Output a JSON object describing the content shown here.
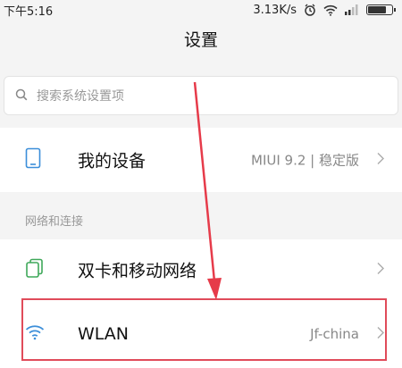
{
  "status_bar": {
    "time": "下午5:16",
    "speed": "3.13K/s"
  },
  "header": {
    "title": "设置"
  },
  "search": {
    "placeholder": "搜索系统设置项"
  },
  "my_device": {
    "label": "我的设备",
    "value": "MIUI 9.2 | 稳定版"
  },
  "sections": {
    "network": "网络和连接"
  },
  "sim": {
    "label": "双卡和移动网络"
  },
  "wlan": {
    "label": "WLAN",
    "value": "Jf-china"
  },
  "colors": {
    "highlight": "#e04b5a",
    "icon_blue": "#3b8ed9",
    "icon_green": "#3fa85a"
  }
}
